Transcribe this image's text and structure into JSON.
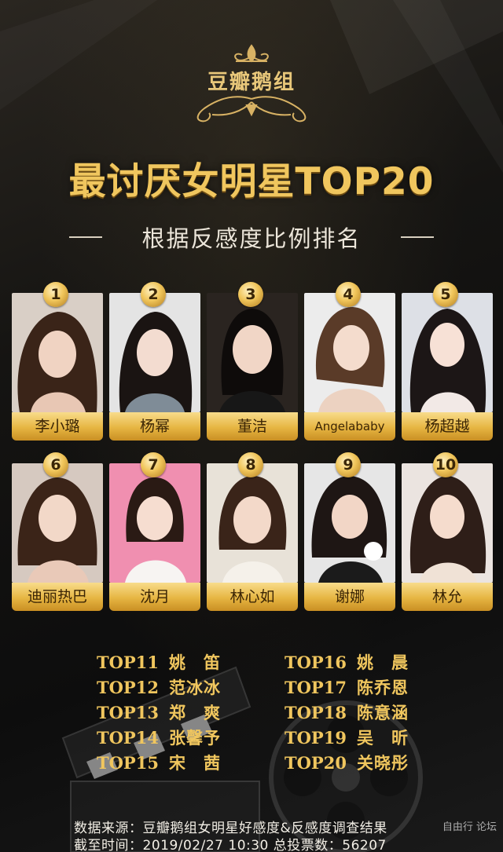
{
  "brand": "豆瓣鹅组",
  "title": "最讨厌女明星TOP20",
  "subtitle": "根据反感度比例排名",
  "top10": [
    {
      "rank": "1",
      "name": "李小璐"
    },
    {
      "rank": "2",
      "name": "杨幂"
    },
    {
      "rank": "3",
      "name": "董洁"
    },
    {
      "rank": "4",
      "name": "Angelababy"
    },
    {
      "rank": "5",
      "name": "杨超越"
    },
    {
      "rank": "6",
      "name": "迪丽热巴"
    },
    {
      "rank": "7",
      "name": "沈月"
    },
    {
      "rank": "8",
      "name": "林心如"
    },
    {
      "rank": "9",
      "name": "谢娜"
    },
    {
      "rank": "10",
      "name": "林允"
    }
  ],
  "list_left": [
    {
      "label": "TOP11",
      "name": "姚　笛"
    },
    {
      "label": "TOP12",
      "name": "范冰冰"
    },
    {
      "label": "TOP13",
      "name": "郑　爽"
    },
    {
      "label": "TOP14",
      "name": "张馨予"
    },
    {
      "label": "TOP15",
      "name": "宋　茜"
    }
  ],
  "list_right": [
    {
      "label": "TOP16",
      "name": "姚　晨"
    },
    {
      "label": "TOP17",
      "name": "陈乔恩"
    },
    {
      "label": "TOP18",
      "name": "陈意涵"
    },
    {
      "label": "TOP19",
      "name": "吴　昕"
    },
    {
      "label": "TOP20",
      "name": "关晓彤"
    }
  ],
  "footer": {
    "source": "数据来源：豆瓣鹅组女明星好感度&反感度调查结果",
    "deadline": "截至时间：2019/02/27 10:30  总投票数：56207"
  },
  "watermark": "自由行 论坛",
  "colors": {
    "gold": "#f0c65e",
    "bg": "#141414"
  }
}
